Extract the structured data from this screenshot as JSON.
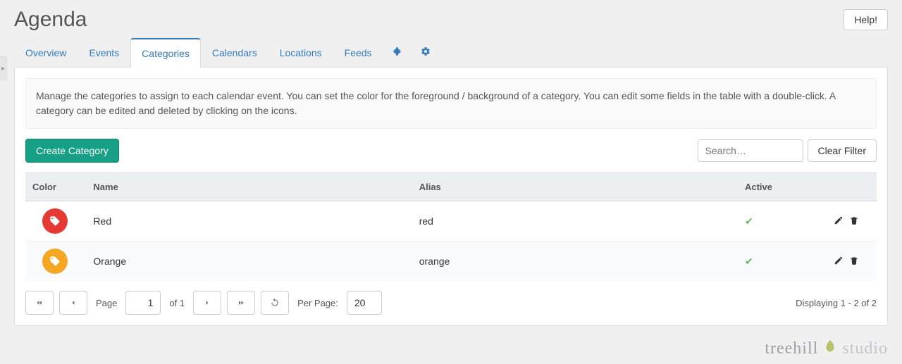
{
  "page": {
    "title": "Agenda",
    "help_label": "Help!"
  },
  "tabs": {
    "overview": "Overview",
    "events": "Events",
    "categories": "Categories",
    "calendars": "Calendars",
    "locations": "Locations",
    "feeds": "Feeds"
  },
  "description": "Manage the categories to assign to each calendar event. You can set the color for the foreground / background of a category. You can edit some fields in the table with a double-click. A category can be edited and deleted by clicking on the icons.",
  "toolbar": {
    "create_label": "Create Category",
    "search_placeholder": "Search…",
    "clear_label": "Clear Filter"
  },
  "columns": {
    "color": "Color",
    "name": "Name",
    "alias": "Alias",
    "active": "Active"
  },
  "rows": [
    {
      "color": "#e53935",
      "name": "Red",
      "alias": "red",
      "active": true
    },
    {
      "color": "#f5a623",
      "name": "Orange",
      "alias": "orange",
      "active": true
    }
  ],
  "pager": {
    "page_label": "Page",
    "page_value": "1",
    "of_label": "of 1",
    "perpage_label": "Per Page:",
    "perpage_value": "20",
    "display_text": "Displaying 1 - 2 of 2"
  },
  "brand": {
    "left": "treehill",
    "right": "studio"
  }
}
